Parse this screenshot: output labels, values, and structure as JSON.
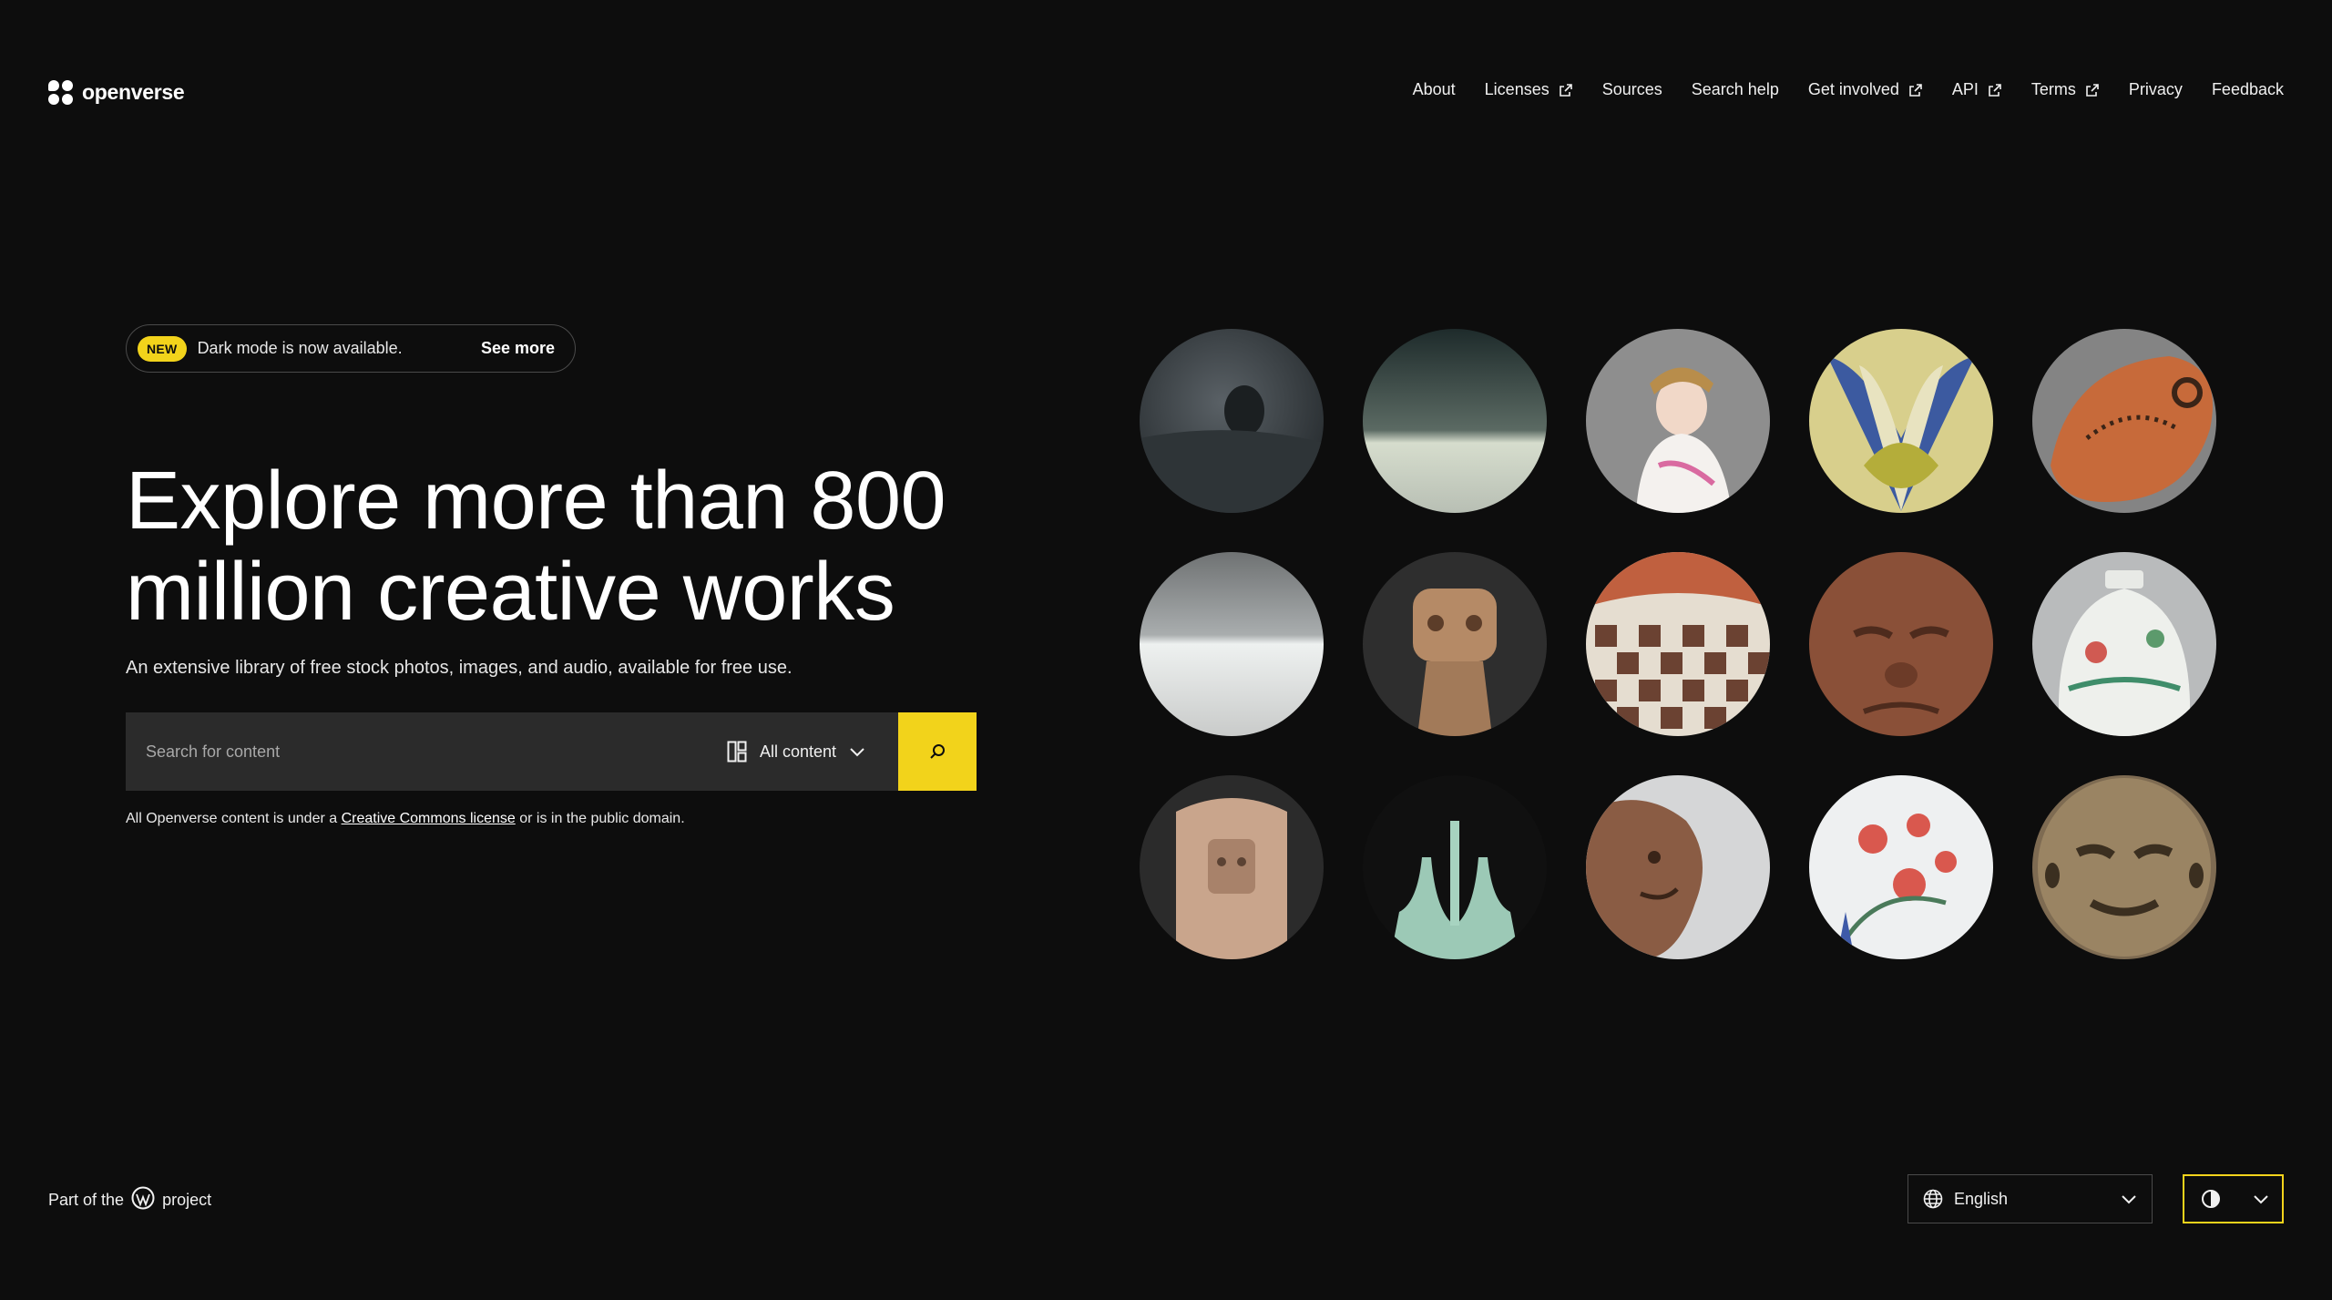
{
  "header": {
    "logo_text": "openverse",
    "nav": [
      {
        "label": "About",
        "external": false
      },
      {
        "label": "Licenses",
        "external": true
      },
      {
        "label": "Sources",
        "external": false
      },
      {
        "label": "Search help",
        "external": false
      },
      {
        "label": "Get involved",
        "external": true
      },
      {
        "label": "API",
        "external": true
      },
      {
        "label": "Terms",
        "external": true
      },
      {
        "label": "Privacy",
        "external": false
      },
      {
        "label": "Feedback",
        "external": false
      }
    ]
  },
  "banner": {
    "badge": "NEW",
    "text": "Dark mode is now available.",
    "link": "See more"
  },
  "hero": {
    "title_line1": "Explore more than 800",
    "title_line2": "million creative works",
    "subtitle": "An extensive library of free stock photos, images, and audio, available for free use."
  },
  "search": {
    "placeholder": "Search for content",
    "content_type": "All content"
  },
  "license_note": {
    "before": "All Openverse content is under a ",
    "link": "Creative Commons license",
    "after": " or is in the public domain."
  },
  "footer": {
    "part_of_before": "Part of the",
    "part_of_after": "project",
    "language": "English"
  },
  "colors": {
    "background": "#0d0d0d",
    "accent": "#f2d31b",
    "search_field": "#2b2b2b"
  }
}
